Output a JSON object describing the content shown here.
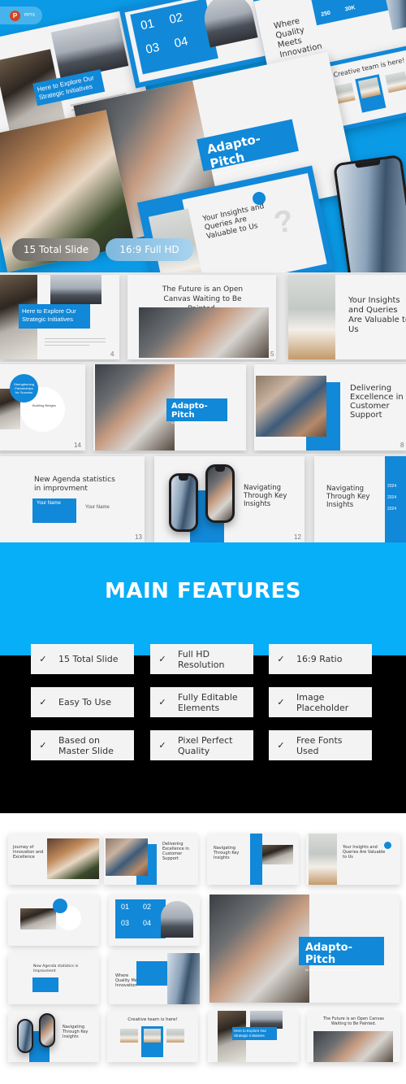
{
  "hero": {
    "badge": {
      "icon": "powerpoint-icon",
      "label": "PPTX"
    },
    "pills": [
      "15 Total Slide",
      "16:9 Full HD"
    ],
    "slides": {
      "explore": {
        "title": "Here to Explore Our Strategic Initiatives"
      },
      "numbers": {
        "items": [
          "01",
          "02",
          "03",
          "04"
        ]
      },
      "quality": {
        "title": "Where Quality Meets Innovation",
        "stats": [
          "250",
          "30K"
        ]
      },
      "creative": {
        "title": "Creative team is here!"
      },
      "cover": {
        "title": "Adapto-Pitch",
        "subtitle": "Multipurpose Presentation"
      },
      "insights": {
        "title": "Your Insights and Queries Are Valuable to Us",
        "mark": "?"
      }
    }
  },
  "row1": {
    "explore": {
      "title": "Here to Explore Our Strategic Initiatives",
      "page": "4"
    },
    "future": {
      "title": "The Future is an Open Canvas Waiting to Be Painted.",
      "page": "5"
    },
    "insights": {
      "title": "Your Insights and Queries Are Valuable to Us"
    }
  },
  "row2": {
    "partner": {
      "circle": "Strengthening Partnerships for Success",
      "subtitle": "Building Bridges",
      "page": "14"
    },
    "cover": {
      "title": "Adapto-Pitch",
      "subtitle": "Multipurpose Presentation"
    },
    "delivering": {
      "title": "Delivering Excellence in Customer Support",
      "page": "8"
    }
  },
  "row3": {
    "agenda": {
      "title": "New Agenda statistics in improvment",
      "card1_name": "Your Name",
      "card2_name": "Your Name",
      "page": "13"
    },
    "navigating1": {
      "title": "Navigating Through Key Insights",
      "page": "12"
    },
    "navigating2": {
      "title": "Navigating Through Key Insights",
      "dates": [
        "2024",
        "2024",
        "2024"
      ]
    }
  },
  "features": {
    "title": "MAIN FEATURES",
    "check_icon": "✓",
    "items": [
      "15 Total Slide",
      "Full HD\nResolution",
      "16:9 Ratio",
      "Easy To Use",
      "Fully Editable\nElements",
      "Image\nPlaceholder",
      "Based on\nMaster Slide",
      "Pixel Perfect\nQuality",
      "Free Fonts\nUsed"
    ]
  },
  "gallery": {
    "journey": "Journey of Innovation and Excellence",
    "delivering": "Delivering Excellence in Customer Support",
    "navigating": "Navigating Through Key Insights",
    "insights": "Your Insights and Queries Are Valuable to Us",
    "numbers": [
      "01",
      "02",
      "03",
      "04"
    ],
    "agenda": "New Agenda statistics in Improvment",
    "quality": "Where Quality Meets Innovation",
    "cover_title": "Adapto-Pitch",
    "cover_subtitle": "Multipurpose Presentation",
    "navigating2": "Navigating Through Key Insights",
    "creative": "Creative team is here!",
    "explore": "Here to Explore Our Strategic Initiatives",
    "future": "The Future is an Open Canvas Waiting to Be Painted."
  },
  "colors": {
    "brand_blue": "#1188d8",
    "feature_blue": "#07aef8",
    "feature_black": "#000000"
  }
}
